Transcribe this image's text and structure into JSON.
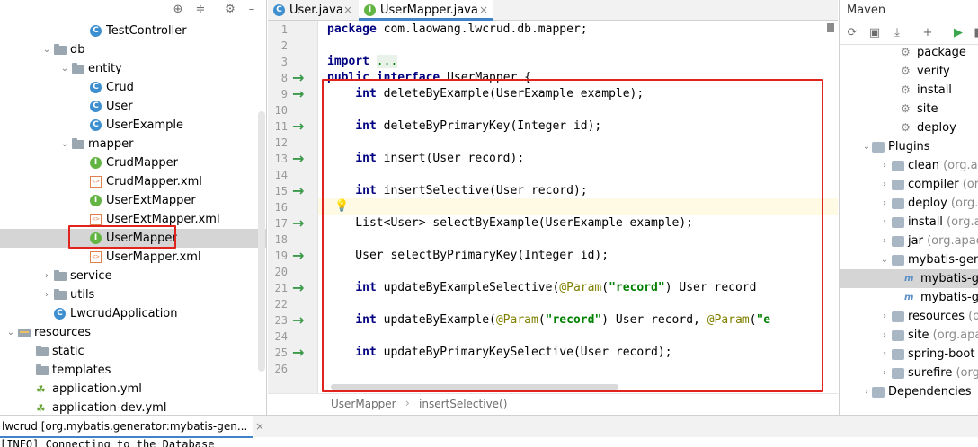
{
  "project_tree": {
    "items": [
      {
        "label": "TestController",
        "kind": "class",
        "indent": 4
      },
      {
        "label": "db",
        "kind": "folder",
        "indent": 2,
        "expanded": true
      },
      {
        "label": "entity",
        "kind": "folder",
        "indent": 3,
        "expanded": true
      },
      {
        "label": "Crud",
        "kind": "class",
        "indent": 4
      },
      {
        "label": "User",
        "kind": "class",
        "indent": 4
      },
      {
        "label": "UserExample",
        "kind": "class",
        "indent": 4
      },
      {
        "label": "mapper",
        "kind": "folder",
        "indent": 3,
        "expanded": true
      },
      {
        "label": "CrudMapper",
        "kind": "interface",
        "indent": 4
      },
      {
        "label": "CrudMapper.xml",
        "kind": "xml",
        "indent": 4
      },
      {
        "label": "UserExtMapper",
        "kind": "interface",
        "indent": 4
      },
      {
        "label": "UserExtMapper.xml",
        "kind": "xml",
        "indent": 4
      },
      {
        "label": "UserMapper",
        "kind": "interface",
        "indent": 4,
        "selected": true
      },
      {
        "label": "UserMapper.xml",
        "kind": "xml",
        "indent": 4
      },
      {
        "label": "service",
        "kind": "folder",
        "indent": 2,
        "expanded": false
      },
      {
        "label": "utils",
        "kind": "folder",
        "indent": 2,
        "expanded": false
      },
      {
        "label": "LwcrudApplication",
        "kind": "class",
        "indent": 2
      },
      {
        "label": "resources",
        "kind": "resources",
        "indent": 0,
        "expanded": true
      },
      {
        "label": "static",
        "kind": "folder",
        "indent": 1
      },
      {
        "label": "templates",
        "kind": "folder",
        "indent": 1
      },
      {
        "label": "application.yml",
        "kind": "yml",
        "indent": 1
      },
      {
        "label": "application-dev.yml",
        "kind": "yml",
        "indent": 1
      }
    ]
  },
  "editor": {
    "tabs": [
      {
        "label": "User.java",
        "icon": "C",
        "active": false
      },
      {
        "label": "UserMapper.java",
        "icon": "I",
        "active": true
      }
    ],
    "lines": [
      {
        "num": "1",
        "arrow": false,
        "segments": [
          {
            "t": "package",
            "c": "kw"
          },
          {
            "t": " com.laowang.lwcrud.db.mapper;",
            "c": ""
          }
        ]
      },
      {
        "num": "2",
        "arrow": false,
        "segments": []
      },
      {
        "num": "3",
        "arrow": false,
        "segments": [
          {
            "t": "import",
            "c": "kw"
          },
          {
            "t": " ",
            "c": ""
          },
          {
            "t": "...",
            "c": "fold-dots"
          }
        ]
      },
      {
        "num": "8",
        "arrow": true,
        "segments": [
          {
            "t": "public",
            "c": "kw"
          },
          {
            "t": " ",
            "c": ""
          },
          {
            "t": "interface",
            "c": "kw"
          },
          {
            "t": " UserMapper {",
            "c": ""
          }
        ]
      },
      {
        "num": "9",
        "arrow": true,
        "segments": [
          {
            "t": "    ",
            "c": ""
          },
          {
            "t": "int",
            "c": "kw"
          },
          {
            "t": " deleteByExample(UserExample example);",
            "c": ""
          }
        ]
      },
      {
        "num": "10",
        "arrow": false,
        "segments": []
      },
      {
        "num": "11",
        "arrow": true,
        "segments": [
          {
            "t": "    ",
            "c": ""
          },
          {
            "t": "int",
            "c": "kw"
          },
          {
            "t": " deleteByPrimaryKey(Integer id);",
            "c": ""
          }
        ]
      },
      {
        "num": "12",
        "arrow": false,
        "segments": []
      },
      {
        "num": "13",
        "arrow": true,
        "segments": [
          {
            "t": "    ",
            "c": ""
          },
          {
            "t": "int",
            "c": "kw"
          },
          {
            "t": " insert(User record);",
            "c": ""
          }
        ]
      },
      {
        "num": "14",
        "arrow": false,
        "segments": []
      },
      {
        "num": "15",
        "arrow": true,
        "segments": [
          {
            "t": "    ",
            "c": ""
          },
          {
            "t": "int",
            "c": "kw"
          },
          {
            "t": " insertSelective(User record);",
            "c": ""
          }
        ]
      },
      {
        "num": "16",
        "arrow": false,
        "segments": []
      },
      {
        "num": "17",
        "arrow": true,
        "segments": [
          {
            "t": "    List<User> selectByExample(UserExample example);",
            "c": ""
          }
        ]
      },
      {
        "num": "18",
        "arrow": false,
        "segments": []
      },
      {
        "num": "19",
        "arrow": true,
        "segments": [
          {
            "t": "    User selectByPrimaryKey(Integer id);",
            "c": ""
          }
        ]
      },
      {
        "num": "20",
        "arrow": false,
        "segments": []
      },
      {
        "num": "21",
        "arrow": true,
        "segments": [
          {
            "t": "    ",
            "c": ""
          },
          {
            "t": "int",
            "c": "kw"
          },
          {
            "t": " updateByExampleSelective(",
            "c": ""
          },
          {
            "t": "@Param",
            "c": "ann"
          },
          {
            "t": "(",
            "c": ""
          },
          {
            "t": "\"record\"",
            "c": "str"
          },
          {
            "t": ") User record",
            "c": ""
          }
        ]
      },
      {
        "num": "22",
        "arrow": false,
        "segments": []
      },
      {
        "num": "23",
        "arrow": true,
        "segments": [
          {
            "t": "    ",
            "c": ""
          },
          {
            "t": "int",
            "c": "kw"
          },
          {
            "t": " updateByExample(",
            "c": ""
          },
          {
            "t": "@Param",
            "c": "ann"
          },
          {
            "t": "(",
            "c": ""
          },
          {
            "t": "\"record\"",
            "c": "str"
          },
          {
            "t": ") User record, ",
            "c": ""
          },
          {
            "t": "@Param",
            "c": "ann"
          },
          {
            "t": "(",
            "c": ""
          },
          {
            "t": "\"e",
            "c": "str"
          }
        ]
      },
      {
        "num": "24",
        "arrow": false,
        "segments": []
      },
      {
        "num": "25",
        "arrow": true,
        "segments": [
          {
            "t": "    ",
            "c": ""
          },
          {
            "t": "int",
            "c": "kw"
          },
          {
            "t": " updateByPrimaryKeySelective(User record);",
            "c": ""
          }
        ]
      },
      {
        "num": "26",
        "arrow": false,
        "segments": []
      }
    ],
    "breadcrumb": [
      "UserMapper",
      "insertSelective()"
    ]
  },
  "maven": {
    "title": "Maven",
    "items": [
      {
        "label": "package",
        "kind": "goal",
        "indent": 3
      },
      {
        "label": "verify",
        "kind": "goal",
        "indent": 3
      },
      {
        "label": "install",
        "kind": "goal",
        "indent": 3
      },
      {
        "label": "site",
        "kind": "goal",
        "indent": 3
      },
      {
        "label": "deploy",
        "kind": "goal",
        "indent": 3
      },
      {
        "label": "Plugins",
        "kind": "group",
        "indent": 1,
        "expanded": true
      },
      {
        "label": "clean",
        "suffix": " (org.ap",
        "kind": "plugin",
        "indent": 2
      },
      {
        "label": "compiler",
        "suffix": " (org",
        "kind": "plugin",
        "indent": 2
      },
      {
        "label": "deploy",
        "suffix": " (org.a",
        "kind": "plugin",
        "indent": 2
      },
      {
        "label": "install",
        "suffix": " (org.ap",
        "kind": "plugin",
        "indent": 2
      },
      {
        "label": "jar",
        "suffix": " (org.apac",
        "kind": "plugin",
        "indent": 2
      },
      {
        "label": "mybatis-gene",
        "suffix": "",
        "kind": "plugin",
        "indent": 2,
        "expanded": true
      },
      {
        "label": "mybatis-g",
        "kind": "mgoal",
        "indent": 3,
        "selected": true
      },
      {
        "label": "mybatis-g",
        "kind": "mgoal",
        "indent": 3
      },
      {
        "label": "resources",
        "suffix": " (o",
        "kind": "plugin",
        "indent": 2
      },
      {
        "label": "site",
        "suffix": " (org.apac",
        "kind": "plugin",
        "indent": 2
      },
      {
        "label": "spring-boot",
        "suffix": "",
        "kind": "plugin",
        "indent": 2
      },
      {
        "label": "surefire",
        "suffix": " (org.",
        "kind": "plugin",
        "indent": 2
      },
      {
        "label": "Dependencies",
        "kind": "group",
        "indent": 1,
        "expanded": false
      }
    ]
  },
  "run_panel": {
    "tab_label": "lwcrud [org.mybatis.generator:mybatis-gen...",
    "console_line": "[INFO] Connecting to the Database"
  }
}
